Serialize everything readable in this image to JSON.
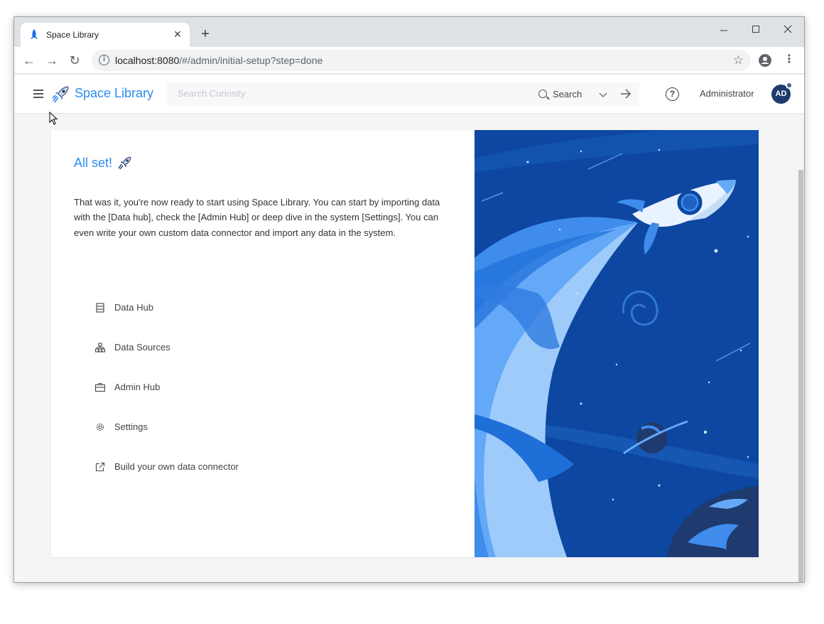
{
  "browser": {
    "tab_title": "Space Library",
    "url_host": "localhost:8080",
    "url_path": "/#/admin/initial-setup?step=done",
    "new_tab_symbol": "+",
    "minimize_symbol": "—",
    "maximize_symbol": "☐",
    "close_symbol": "✕",
    "back_symbol": "←",
    "forward_symbol": "→",
    "reload_symbol": "↻"
  },
  "app": {
    "brand": "Space Library",
    "brand_color": "#2d8cf0",
    "search": {
      "placeholder": "Search Curiosity",
      "button_label": "Search"
    },
    "user": {
      "name": "Administrator",
      "initials": "AD"
    }
  },
  "setup": {
    "title": "All set!",
    "description": "That was it, you're now ready to start using Space Library. You can start by importing data with the [Data hub], check the [Admin Hub] or deep dive in the system [Settings]. You can even write your own custom data connector and import any data in the system.",
    "links": [
      {
        "label": "Data Hub",
        "icon": "database-icon"
      },
      {
        "label": "Data Sources",
        "icon": "sitemap-icon"
      },
      {
        "label": "Admin Hub",
        "icon": "briefcase-icon"
      },
      {
        "label": "Settings",
        "icon": "gear-icon"
      },
      {
        "label": "Build your own data connector",
        "icon": "external-link-icon"
      }
    ]
  },
  "colors": {
    "illustration_bg": "#0d47a1",
    "illustration_light": "#64a9f7",
    "avatar_bg": "#1f3a6e"
  }
}
